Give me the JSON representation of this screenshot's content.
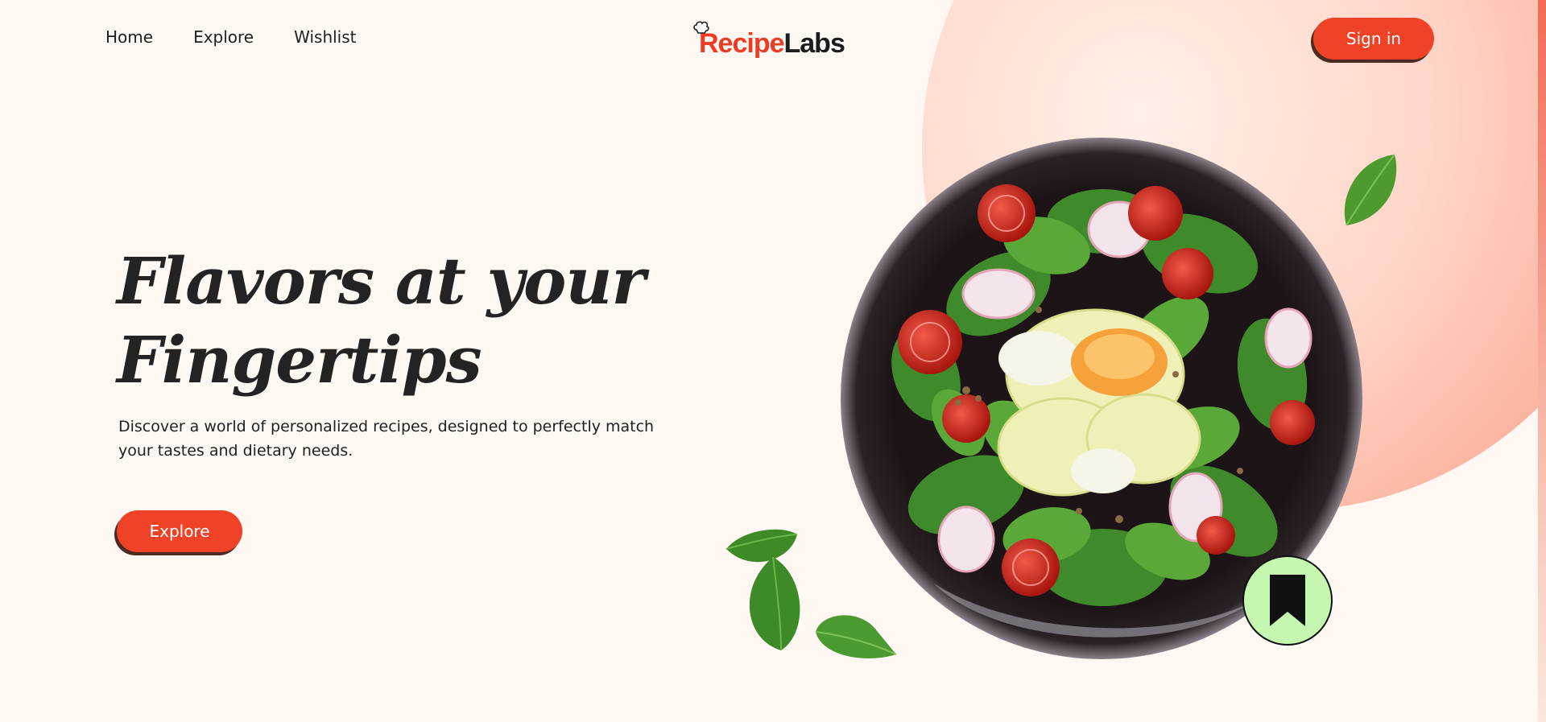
{
  "nav": {
    "items": [
      {
        "label": "Home"
      },
      {
        "label": "Explore"
      },
      {
        "label": "Wishlist"
      }
    ]
  },
  "logo": {
    "part1": "Recipe",
    "part2": "Labs"
  },
  "header": {
    "signin_label": "Sign in"
  },
  "hero": {
    "headline_line1": "Flavors at your",
    "headline_line2": "Fingertips",
    "subtitle": "Discover a world of personalized recipes, designed to perfectly match your tastes and dietary needs.",
    "cta_label": "Explore"
  },
  "icons": {
    "chef_hat": "chef-hat-icon",
    "bookmark": "bookmark-icon",
    "salad": "salad-bowl-image",
    "leaf": "spinach-leaf-image"
  },
  "colors": {
    "accent": "#ef4226",
    "background": "#fff8f2",
    "bookmark_bg": "#c6f7b1",
    "blob": "#fbb09c"
  }
}
